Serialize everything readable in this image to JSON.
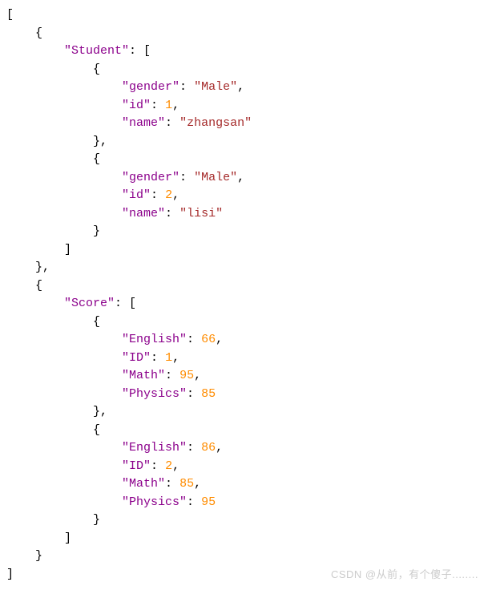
{
  "json": {
    "items": [
      {
        "key": "Student",
        "entries": [
          {
            "fields": [
              {
                "k": "gender",
                "v": "Male",
                "type": "string"
              },
              {
                "k": "id",
                "v": 1,
                "type": "number"
              },
              {
                "k": "name",
                "v": "zhangsan",
                "type": "string"
              }
            ]
          },
          {
            "fields": [
              {
                "k": "gender",
                "v": "Male",
                "type": "string"
              },
              {
                "k": "id",
                "v": 2,
                "type": "number"
              },
              {
                "k": "name",
                "v": "lisi",
                "type": "string"
              }
            ]
          }
        ]
      },
      {
        "key": "Score",
        "entries": [
          {
            "fields": [
              {
                "k": "English",
                "v": 66,
                "type": "number"
              },
              {
                "k": "ID",
                "v": 1,
                "type": "number"
              },
              {
                "k": "Math",
                "v": 95,
                "type": "number"
              },
              {
                "k": "Physics",
                "v": 85,
                "type": "number"
              }
            ]
          },
          {
            "fields": [
              {
                "k": "English",
                "v": 86,
                "type": "number"
              },
              {
                "k": "ID",
                "v": 2,
                "type": "number"
              },
              {
                "k": "Math",
                "v": 85,
                "type": "number"
              },
              {
                "k": "Physics",
                "v": 95,
                "type": "number"
              }
            ]
          }
        ]
      }
    ]
  },
  "watermark": "CSDN @从前，有个傻子........"
}
